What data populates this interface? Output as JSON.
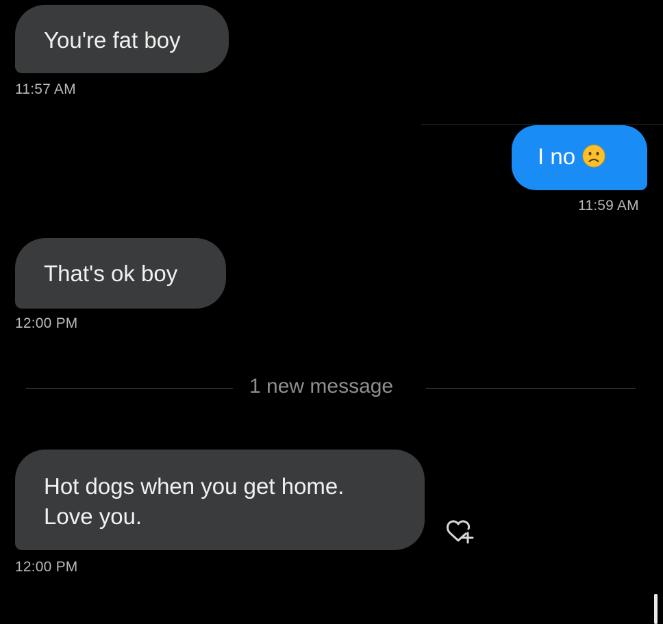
{
  "conversation": {
    "messages": [
      {
        "direction": "incoming",
        "text": "You're fat boy",
        "time": "11:57 AM"
      },
      {
        "direction": "outgoing",
        "text": "I no",
        "emoji": "frowning-face",
        "time": "11:59 AM"
      },
      {
        "direction": "incoming",
        "text": "That's ok boy",
        "time": "12:00 PM"
      },
      {
        "direction": "incoming",
        "text_lines": [
          "Hot dogs when you get home.",
          "Love you."
        ],
        "time": "12:00 PM"
      }
    ],
    "new_message_divider": "1 new message"
  },
  "icons": {
    "reaction": "heart-plus-icon",
    "emoji": "frowning-face-emoji"
  },
  "colors": {
    "background": "#000000",
    "incoming_bubble": "#3a3b3d",
    "outgoing_bubble": "#1a8cf5",
    "timestamp": "#b9b9bb"
  }
}
